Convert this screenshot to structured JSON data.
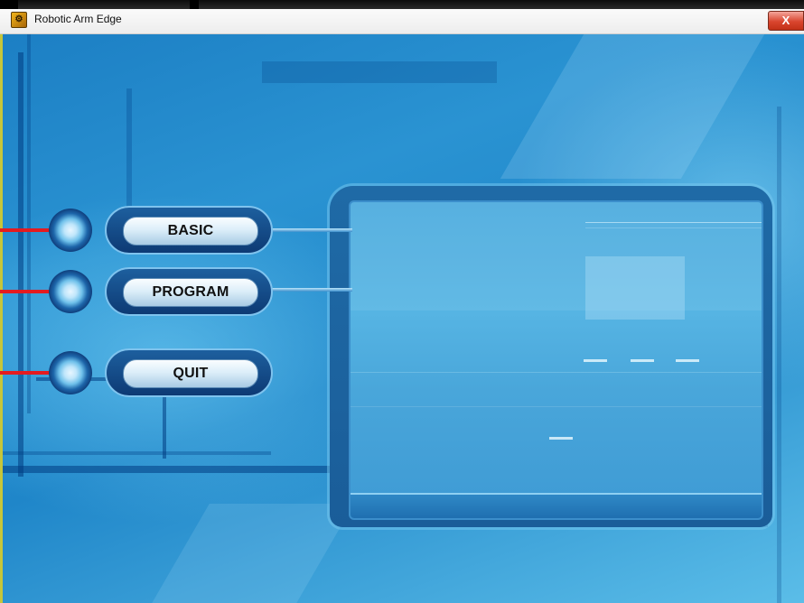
{
  "window": {
    "title": "Robotic Arm Edge",
    "close_symbol": "X",
    "icon": "robotic-arm-app-icon"
  },
  "menu": {
    "basic_label": "BASIC",
    "program_label": "PROGRAM",
    "quit_label": "QUIT"
  },
  "colors": {
    "background": "#2a93d2",
    "pointer_line": "#e41b20",
    "button_face": "#dceef9"
  }
}
